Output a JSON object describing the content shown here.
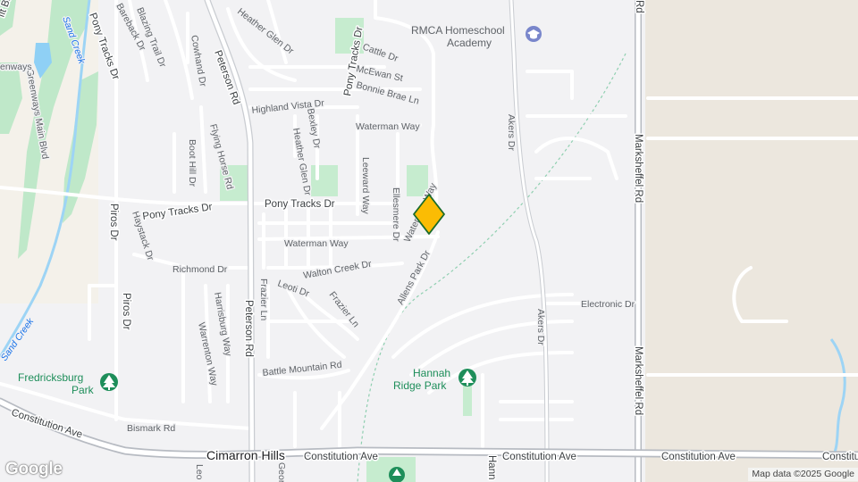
{
  "map": {
    "attribution": "Map data ©2025 Google",
    "logo_text": "Google",
    "place_label": "Cimarron Hills",
    "colors": {
      "background": "#f2f2f4",
      "desert": "#ece7de",
      "road": "#ffffff",
      "road_major": "#c9ccd1",
      "green": "#c6eccf",
      "green_dark": "#a8dfb5",
      "water": "#9dd4f5",
      "pin_fill": "#fbbc04",
      "pin_stroke": "#1a6b2a"
    }
  },
  "streets": {
    "heather_glen_dr_n": "Heather Glen Dr",
    "bareback_dr": "Bareback Dr",
    "blazing_trail_dr": "Blazing Trail Dr",
    "cowhand_dr": "Cowhand Dr",
    "peterson_rd_n": "Peterson Rd",
    "pony_tracks_dr_w": "Pony Tracks Dr",
    "pony_tracks_dr_n": "Pony Tracks Dr",
    "cattle_dr": "Cattle Dr",
    "mcewan_st": "McEwan St",
    "bonnie_brae_ln": "Bonnie Brae Ln",
    "highland_vista_dr": "Highland Vista Dr",
    "bexley_dr": "Bexley Dr",
    "heather_glen_dr_s": "Heather Glen Dr",
    "waterman_way_n": "Waterman Way",
    "leeward_way": "Leeward Way",
    "ellesmere_dr": "Ellesmere Dr",
    "waterman_way_diag": "Waterman Way",
    "flying_horse_rd": "Flying Horse Rd",
    "boot_hill_dr": "Boot Hill Dr",
    "piros_dr_n": "Piros Dr",
    "haystack_dr": "Haystack Dr",
    "pony_tracks_dr_mid": "Pony Tracks Dr",
    "waterman_way_s": "Waterman Way",
    "richmond_dr": "Richmond Dr",
    "walton_creek_dr": "Walton Creek Dr",
    "allens_park_dr": "Allens Park Dr",
    "frazier_ln_v": "Frazier Ln",
    "leoti_dr": "Leoti Dr",
    "frazier_ln_d": "Frazier Ln",
    "harrisburg_way": "Harrisburg Way",
    "warrenton_way": "Warrenton Way",
    "peterson_rd_s": "Peterson Rd",
    "piros_dr_s": "Piros Dr",
    "battle_mountain_rd": "Battle Mountain Rd",
    "bismark_rd": "Bismark Rd",
    "constitution_ave_w": "Constitution Ave",
    "constitution_ave_c": "Constitution Ave",
    "constitution_ave_m": "Constitution Ave",
    "constitution_ave_e1": "Constitution Ave",
    "constitution_ave_e2": "Constitution Ave",
    "electronic_dr": "Electronic Dr",
    "akers_dr_n": "Akers Dr",
    "akers_dr_s": "Akers Dr",
    "marksheffel_rd_top": "Rd",
    "marksheffel_rd_mid": "Marksheffel Rd",
    "marksheffel_rd_low": "Marksheffel Rd",
    "greenways_main_blvd": "Greenways Main Blvd",
    "sand_creek_n": "Sand Creek",
    "sand_creek_s": "Sand Creek",
    "georgia": "Georgia",
    "leo": "Leo",
    "hann": "Hann",
    "fit_bl": "fit Bl",
    "enways": "enways"
  },
  "pois": {
    "school_line1": "RMCA Homeschool",
    "school_line2": "Academy",
    "fredricksburg_line1": "Fredricksburg",
    "fredricksburg_line2": "Park",
    "hannah_line1": "Hannah",
    "hannah_line2": "Ridge Park"
  },
  "icons": {
    "school": "graduation-cap-icon",
    "park": "tree-icon",
    "pin": "location-pin-icon"
  }
}
